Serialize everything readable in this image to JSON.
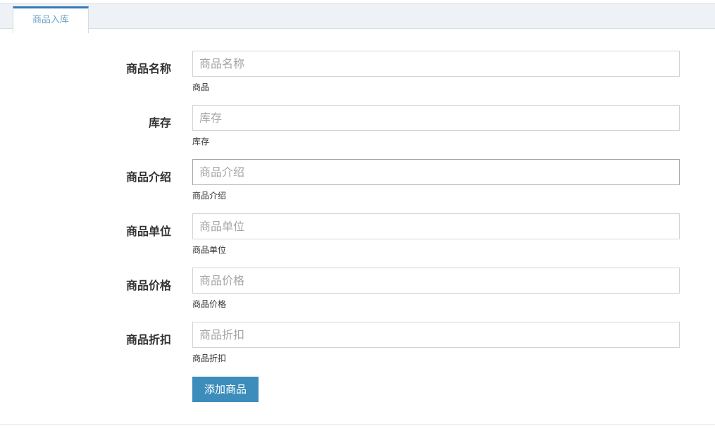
{
  "tabs": [
    {
      "label": "商品入库",
      "active": true
    }
  ],
  "form": {
    "fields": [
      {
        "label": "商品名称",
        "placeholder": "商品名称",
        "value": "",
        "help": "商品"
      },
      {
        "label": "库存",
        "placeholder": "库存",
        "value": "",
        "help": "库存"
      },
      {
        "label": "商品介绍",
        "placeholder": "商品介绍",
        "value": "",
        "help": "商品介绍"
      },
      {
        "label": "商品单位",
        "placeholder": "商品单位",
        "value": "",
        "help": "商品单位"
      },
      {
        "label": "商品价格",
        "placeholder": "商品价格",
        "value": "",
        "help": "商品价格"
      },
      {
        "label": "商品折扣",
        "placeholder": "商品折扣",
        "value": "",
        "help": "商品折扣"
      }
    ],
    "submit_label": "添加商品"
  },
  "colors": {
    "accent": "#337ab7",
    "button": "#3c8dbc",
    "tab_text": "#6ea3c9",
    "tabbar_bg": "#eef1f5"
  }
}
